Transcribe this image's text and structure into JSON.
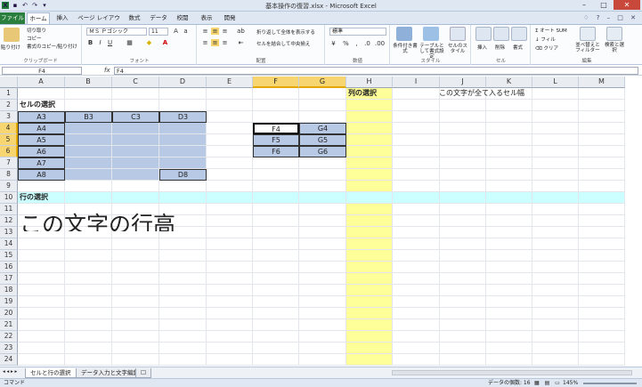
{
  "window": {
    "title": "基本操作の復習.xlsx - Microsoft Excel",
    "app_icon": "excel-icon"
  },
  "ribbon_tabs": [
    "ファイル",
    "ホーム",
    "挿入",
    "ページ レイアウト",
    "数式",
    "データ",
    "校閲",
    "表示",
    "開発"
  ],
  "ribbon": {
    "clipboard": {
      "label": "クリップボード",
      "paste": "貼り付け",
      "cut": "切り取り",
      "copy": "コピー",
      "format_painter": "書式のコピー/貼り付け"
    },
    "font": {
      "label": "フォント",
      "name": "ＭＳ Ｐゴシック",
      "size": "11"
    },
    "alignment": {
      "label": "配置",
      "wrap": "折り返して全体を表示する",
      "merge": "セルを結合して中央揃え"
    },
    "number": {
      "label": "数値",
      "format": "標準"
    },
    "styles": {
      "label": "スタイル",
      "conditional": "条件付き書式",
      "table": "テーブルとして書式設定",
      "cell": "セルのスタイル"
    },
    "cells": {
      "label": "セル",
      "insert": "挿入",
      "delete": "削除",
      "format": "書式"
    },
    "editing": {
      "label": "編集",
      "autosum": "オート SUM",
      "fill": "フィル",
      "clear": "クリア",
      "sort": "並べ替えとフィルター",
      "find": "検索と選択"
    }
  },
  "formula_bar": {
    "name_box": "F4",
    "fx": "fx",
    "value": "F4"
  },
  "columns": [
    "A",
    "B",
    "C",
    "D",
    "E",
    "F",
    "G",
    "H",
    "I",
    "J",
    "K",
    "L",
    "M"
  ],
  "rows": [
    "1",
    "2",
    "3",
    "4",
    "5",
    "6",
    "7",
    "8",
    "9",
    "10",
    "11",
    "12",
    "13",
    "14",
    "15",
    "16",
    "17",
    "18",
    "19",
    "20",
    "21",
    "22",
    "23",
    "24"
  ],
  "cells": {
    "H1": "列の選択",
    "J1": "この文字が全て入るセル幅",
    "A2": "セルの選択",
    "A3": "A3",
    "B3": "B3",
    "C3": "C3",
    "D3": "D3",
    "A4": "A4",
    "A5": "A5",
    "A6": "A6",
    "A7": "A7",
    "A8": "A8",
    "D8": "D8",
    "F4": "F4",
    "G4": "G4",
    "F5": "F5",
    "G5": "G5",
    "F6": "F6",
    "G6": "G6",
    "A10": "行の選択",
    "A12": "この文字の行高"
  },
  "sheet_tabs": [
    "セルと行の選択",
    "データ入力と文字編集"
  ],
  "status": {
    "mode": "コマンド",
    "count": "データの個数: 16",
    "zoom": "145%"
  },
  "colors": {
    "selection": "#b8c9e5",
    "column_highlight": "#ffff99",
    "row_highlight": "#ccffff",
    "excel_green": "#1f7a3a"
  }
}
